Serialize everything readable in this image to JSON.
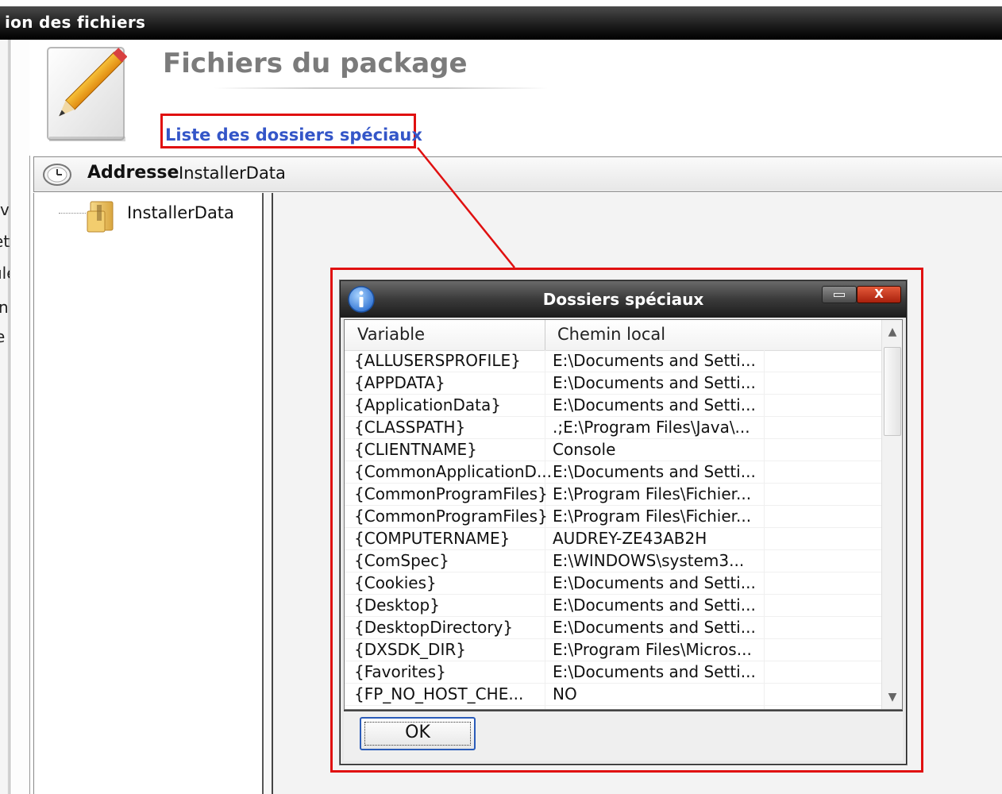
{
  "window": {
    "title_partial": "ion des fichiers"
  },
  "left_edge_fragments": [
    "ve",
    "ets",
    "ule",
    "ni",
    "e"
  ],
  "header": {
    "title": "Fichiers du package",
    "link": "Liste des dossiers spéciaux",
    "icon": "document-pencil-icon"
  },
  "address_bar": {
    "label": "Addresse",
    "value": "InstallerData",
    "icon": "clock-icon"
  },
  "tree": {
    "items": [
      {
        "label": "InstallerData",
        "icon": "folder-icon"
      }
    ]
  },
  "dialog": {
    "title": "Dossiers spéciaux",
    "icon": "info-icon",
    "close_label": "X",
    "columns": [
      "Variable",
      "Chemin local"
    ],
    "rows": [
      {
        "variable": "{ALLUSERSPROFILE}",
        "path": "E:\\Documents and Setti..."
      },
      {
        "variable": "{APPDATA}",
        "path": "E:\\Documents and Setti..."
      },
      {
        "variable": "{ApplicationData}",
        "path": "E:\\Documents and Setti..."
      },
      {
        "variable": "{CLASSPATH}",
        "path": ".;E:\\Program Files\\Java\\..."
      },
      {
        "variable": "{CLIENTNAME}",
        "path": "Console"
      },
      {
        "variable": "{CommonApplicationD...",
        "path": "E:\\Documents and Setti..."
      },
      {
        "variable": "{CommonProgramFiles}",
        "path": "E:\\Program Files\\Fichier..."
      },
      {
        "variable": "{CommonProgramFiles}",
        "path": "E:\\Program Files\\Fichier..."
      },
      {
        "variable": "{COMPUTERNAME}",
        "path": "AUDREY-ZE43AB2H"
      },
      {
        "variable": "{ComSpec}",
        "path": "E:\\WINDOWS\\system3..."
      },
      {
        "variable": "{Cookies}",
        "path": "E:\\Documents and Setti..."
      },
      {
        "variable": "{Desktop}",
        "path": "E:\\Documents and Setti..."
      },
      {
        "variable": "{DesktopDirectory}",
        "path": "E:\\Documents and Setti..."
      },
      {
        "variable": "{DXSDK_DIR}",
        "path": "E:\\Program Files\\Micros..."
      },
      {
        "variable": "{Favorites}",
        "path": "E:\\Documents and Setti..."
      },
      {
        "variable": "{FP_NO_HOST_CHE...",
        "path": "NO"
      }
    ],
    "ok_label": "OK"
  },
  "colors": {
    "highlight": "#e01010",
    "link": "#3456c8",
    "title_gray": "#7b7b7b"
  }
}
